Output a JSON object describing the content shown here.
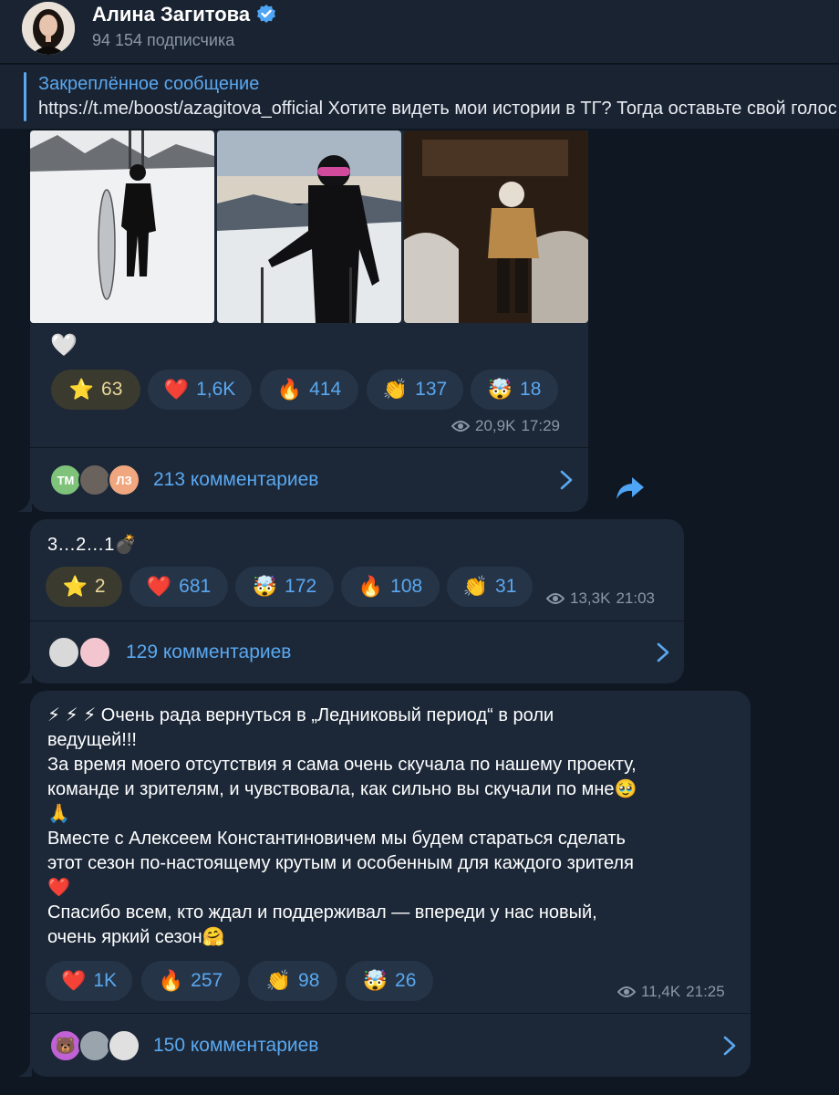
{
  "header": {
    "channel_name": "Алина Загитова",
    "subscribers": "94 154 подписчика"
  },
  "pinned": {
    "title": "Закреплённое сообщение",
    "text": "https://t.me/boost/azagitova_official  Хотите видеть мои истории в ТГ?  Тогда оставьте свой голос"
  },
  "messages": [
    {
      "caption": "🤍",
      "reactions": [
        {
          "emoji": "⭐",
          "count": "63"
        },
        {
          "emoji": "❤️",
          "count": "1,6K"
        },
        {
          "emoji": "🔥",
          "count": "414"
        },
        {
          "emoji": "👏",
          "count": "137"
        },
        {
          "emoji": "🤯",
          "count": "18"
        }
      ],
      "views": "20,9K",
      "time": "17:29",
      "comments": "213 комментариев",
      "comment_avatars": [
        "ТМ",
        "",
        "ЛЗ"
      ]
    },
    {
      "text": "3…2…1💣",
      "reactions": [
        {
          "emoji": "⭐",
          "count": "2"
        },
        {
          "emoji": "❤️",
          "count": "681"
        },
        {
          "emoji": "🤯",
          "count": "172"
        },
        {
          "emoji": "🔥",
          "count": "108"
        },
        {
          "emoji": "👏",
          "count": "31"
        }
      ],
      "views": "13,3K",
      "time": "21:03",
      "comments": "129 комментариев"
    },
    {
      "lines": [
        "⚡ ⚡ ⚡ Очень рада вернуться в „Ледниковый период“ в роли",
        "ведущей!!!",
        "За время моего отсутствия я сама очень скучала по нашему проекту,",
        "команде и зрителям, и чувствовала, как сильно вы скучали по мне🥹",
        "🙏",
        "Вместе с Алексеем Константиновичем мы будем стараться сделать",
        "этот сезон по-настоящему крутым и особенным для каждого зрителя",
        "❤️",
        "Спасибо всем, кто ждал и поддерживал — впереди у нас новый,",
        "очень яркий сезон🤗"
      ],
      "reactions": [
        {
          "emoji": "❤️",
          "count": "1K"
        },
        {
          "emoji": "🔥",
          "count": "257"
        },
        {
          "emoji": "👏",
          "count": "98"
        },
        {
          "emoji": "🤯",
          "count": "26"
        }
      ],
      "views": "11,4K",
      "time": "21:25",
      "comments": "150 комментариев"
    }
  ],
  "colors": {
    "background": "#0f1722",
    "bubble": "#1c2838",
    "accent": "#5aa8f0",
    "muted": "#8b97a6"
  },
  "icons": [
    "verified-badge-icon",
    "eye-icon",
    "chevron-right-icon",
    "share-arrow-icon"
  ]
}
